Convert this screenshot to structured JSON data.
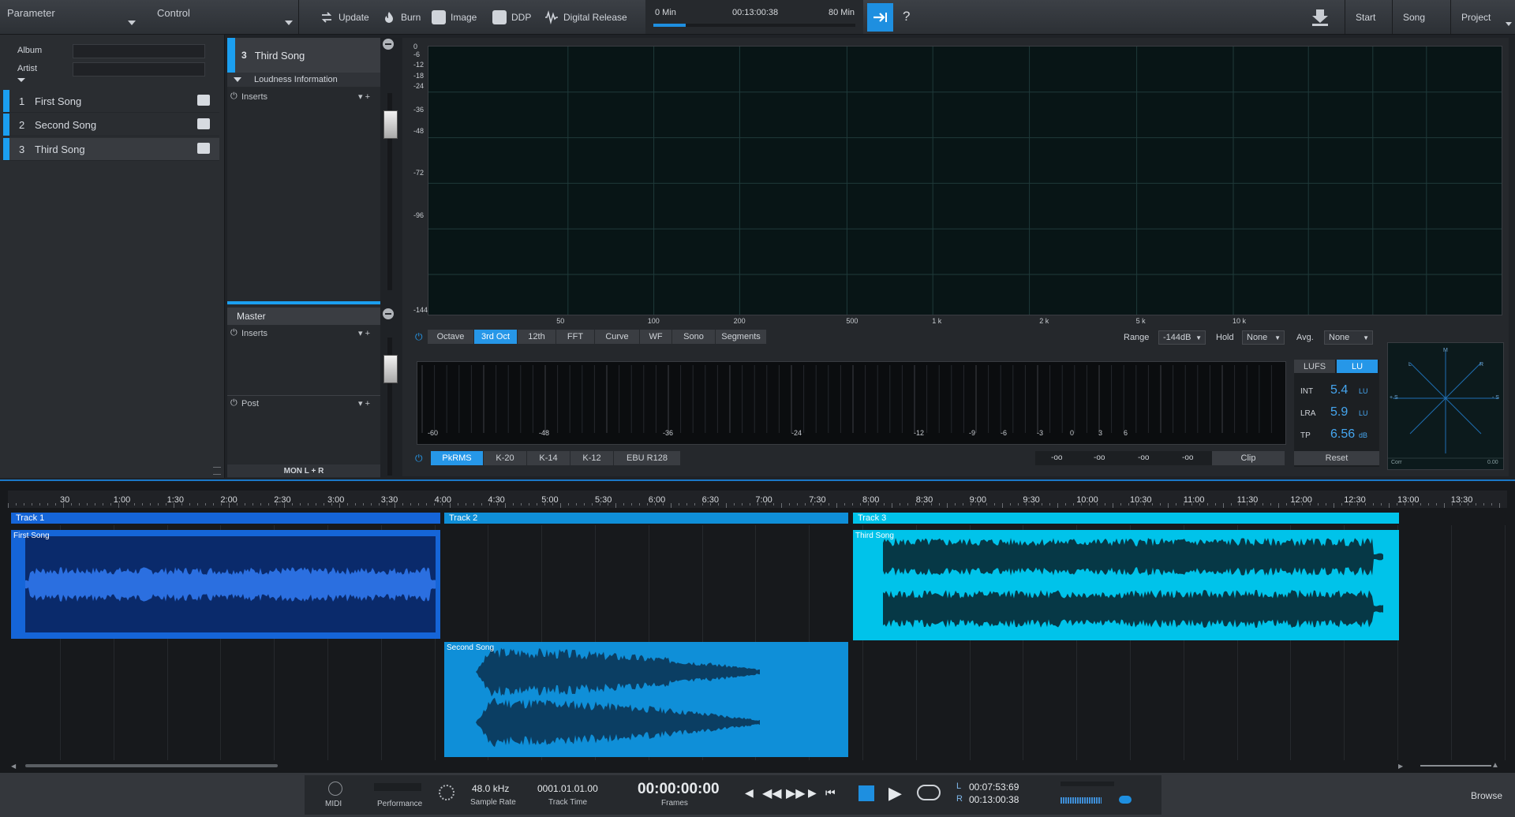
{
  "toolbar": {
    "parameter_label": "Parameter",
    "control_label": "Control",
    "update": "Update",
    "burn": "Burn",
    "image": "Image",
    "ddp": "DDP",
    "digital_release": "Digital Release",
    "time_start": "0 Min",
    "time_current": "00:13:00:38",
    "time_end": "80 Min",
    "help": "?",
    "start": "Start",
    "song": "Song",
    "project": "Project",
    "progress_fraction": 0.16
  },
  "album": {
    "album_label": "Album",
    "artist_label": "Artist"
  },
  "songs": [
    {
      "num": "1",
      "title": "First Song"
    },
    {
      "num": "2",
      "title": "Second Song"
    },
    {
      "num": "3",
      "title": "Third Song"
    }
  ],
  "inserts_panel": {
    "song_num": "3",
    "song_title": "Third Song",
    "loudness": "Loudness Information",
    "inserts": "Inserts",
    "master": "Master",
    "master_inserts": "Inserts",
    "post": "Post",
    "mon": "MON L + R"
  },
  "analyzer": {
    "y_ticks": [
      "0",
      "-6",
      "-12",
      "-18",
      "-24",
      "-36",
      "-48",
      "-72",
      "-96",
      "-144"
    ],
    "x_ticks": [
      "50",
      "100",
      "200",
      "500",
      "1 k",
      "2 k",
      "5 k",
      "10 k"
    ],
    "modes": [
      "Octave",
      "3rd Oct",
      "12th",
      "FFT",
      "Curve",
      "WF",
      "Sono",
      "Segments"
    ],
    "active_mode": "3rd Oct",
    "range_label": "Range",
    "range_value": "-144dB",
    "hold_label": "Hold",
    "hold_value": "None",
    "avg_label": "Avg.",
    "avg_value": "None",
    "meter_ticks": [
      "-60",
      "-48",
      "-36",
      "-24",
      "-12",
      "-9",
      "-6",
      "-3",
      "0",
      "3",
      "6"
    ],
    "meter_modes": [
      "PkRMS",
      "K-20",
      "K-14",
      "K-12",
      "EBU R128"
    ],
    "active_meter_mode": "PkRMS",
    "peak_readouts": [
      "-oo",
      "-oo",
      "-oo",
      "-oo"
    ],
    "clip": "Clip"
  },
  "loudness": {
    "lufs": "LUFS",
    "lu": "LU",
    "int_label": "INT",
    "int_value": "5.4",
    "int_unit": "LU",
    "lra_label": "LRA",
    "lra_value": "5.9",
    "lra_unit": "LU",
    "tp_label": "TP",
    "tp_value": "6.56",
    "tp_unit": "dB",
    "reset": "Reset"
  },
  "vectorscope": {
    "m": "M",
    "l": "L",
    "r": "R",
    "plus_s": "+ S",
    "minus_s": "- S",
    "corr": "Corr",
    "corr_value": "0.00"
  },
  "timeline": {
    "ruler": [
      "30",
      "1:00",
      "1:30",
      "2:00",
      "2:30",
      "3:00",
      "3:30",
      "4:00",
      "4:30",
      "5:00",
      "5:30",
      "6:00",
      "6:30",
      "7:00",
      "7:30",
      "8:00",
      "8:30",
      "9:00",
      "9:30",
      "10:00",
      "10:30",
      "11:00",
      "11:30",
      "12:00",
      "12:30",
      "13:00",
      "13:30"
    ],
    "tracks": [
      {
        "header": "Track 1",
        "clip": "First Song"
      },
      {
        "header": "Track 2",
        "clip": "Second Song"
      },
      {
        "header": "Track 3",
        "clip": "Third Song"
      }
    ],
    "colors": {
      "track1": "#1565d8",
      "track2": "#0f8fd8",
      "track3": "#00c3ea"
    }
  },
  "transport": {
    "midi": "MIDI",
    "performance": "Performance",
    "sample_rate": "48.0 kHz",
    "sample_rate_label": "Sample Rate",
    "track_time": "0001.01.01.00",
    "track_time_label": "Track Time",
    "frames": "00:00:00:00",
    "frames_label": "Frames",
    "l_label": "L",
    "l_time": "00:07:53:69",
    "r_label": "R",
    "r_time": "00:13:00:38",
    "browse": "Browse"
  }
}
